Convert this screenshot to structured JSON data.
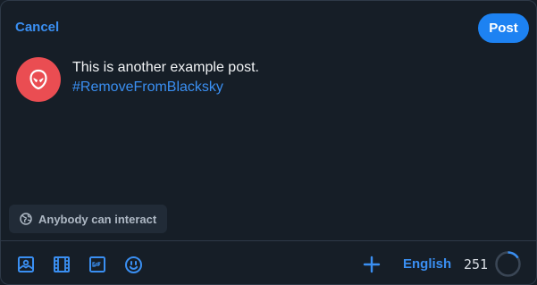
{
  "header": {
    "cancel_label": "Cancel",
    "post_label": "Post"
  },
  "avatar": {
    "icon": "alien-icon",
    "color": "#ea4d52"
  },
  "post": {
    "text": "This is another example post.",
    "hashtag": "#RemoveFromBlacksky"
  },
  "interaction": {
    "label": "Anybody can interact",
    "icon": "earth-icon"
  },
  "toolbar": {
    "tools": [
      "image-icon",
      "video-icon",
      "gif-icon",
      "emoji-icon"
    ],
    "add_icon": "plus-icon",
    "language": "English",
    "char_remaining": "251",
    "char_progress": 0.16
  },
  "colors": {
    "accent": "#3a8ff2",
    "post_button": "#1d82f2",
    "background": "#161e27"
  }
}
